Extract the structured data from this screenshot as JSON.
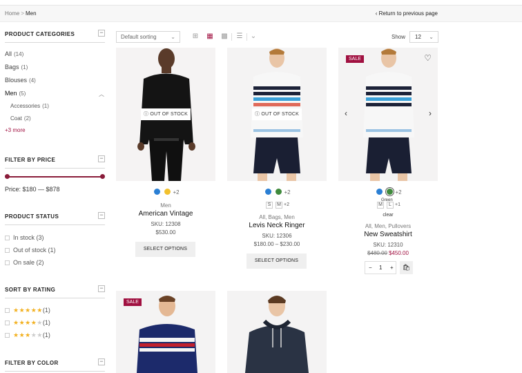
{
  "breadcrumb": {
    "home": "Home",
    "separator": ">",
    "current": "Men"
  },
  "back_link": "Return to previous page",
  "filters": {
    "categories": {
      "title": "PRODUCT CATEGORIES",
      "items": [
        {
          "label": "All",
          "count": "(14)"
        },
        {
          "label": "Bags",
          "count": "(1)"
        },
        {
          "label": "Blouses",
          "count": "(4)"
        },
        {
          "label": "Men",
          "count": "(5)"
        }
      ],
      "subitems": [
        {
          "label": "Accessories",
          "count": "(1)"
        },
        {
          "label": "Coat",
          "count": "(2)"
        }
      ],
      "more": "+3 more"
    },
    "price": {
      "title": "FILTER BY PRICE",
      "label": "Price: $180 — $878"
    },
    "status": {
      "title": "PRODUCT STATUS",
      "items": [
        {
          "label": "In stock",
          "count": "(3)"
        },
        {
          "label": "Out of stock",
          "count": "(1)"
        },
        {
          "label": "On sale",
          "count": "(2)"
        }
      ]
    },
    "rating": {
      "title": "SORT BY RATING",
      "items": [
        {
          "stars": 5,
          "count": "(1)"
        },
        {
          "stars": 4,
          "count": "(1)"
        },
        {
          "stars": 3,
          "count": "(1)"
        }
      ]
    },
    "color": {
      "title": "FILTER BY COLOR"
    }
  },
  "toolbar": {
    "sort": "Default sorting",
    "show_label": "Show",
    "show_value": "12"
  },
  "products": [
    {
      "name": "American Vintage",
      "category": "Men",
      "sku": "SKU: 12308",
      "price": "$530.00",
      "badge": "OUT OF STOCK",
      "more_colors": "+2",
      "button": "SELECT OPTIONS"
    },
    {
      "name": "Levis Neck Ringer",
      "category": "All, Bags, Men",
      "sku": "SKU: 12306",
      "price": "$180.00 – $230.00",
      "badge": "OUT OF STOCK",
      "more_colors": "+2",
      "sizes": [
        "S",
        "M"
      ],
      "more_sizes": "+2",
      "button": "SELECT OPTIONS"
    },
    {
      "name": "New Sweatshirt",
      "category": "All, Men, Pullovers",
      "sku": "SKU: 12310",
      "old_price": "$480.00",
      "new_price": "$450.00",
      "badge": "SALE",
      "more_colors": "+2",
      "sizes": [
        "M",
        "L"
      ],
      "more_sizes": "+1",
      "tooltip": "Green",
      "clear": "clear",
      "quantity": "1"
    },
    {
      "badge": "SALE"
    },
    {}
  ],
  "colors": {
    "accent": "#a01040",
    "blue": "#2a7fd4",
    "yellow": "#f2c12e",
    "green": "#3f8a3c",
    "star": "#f2b01e"
  }
}
